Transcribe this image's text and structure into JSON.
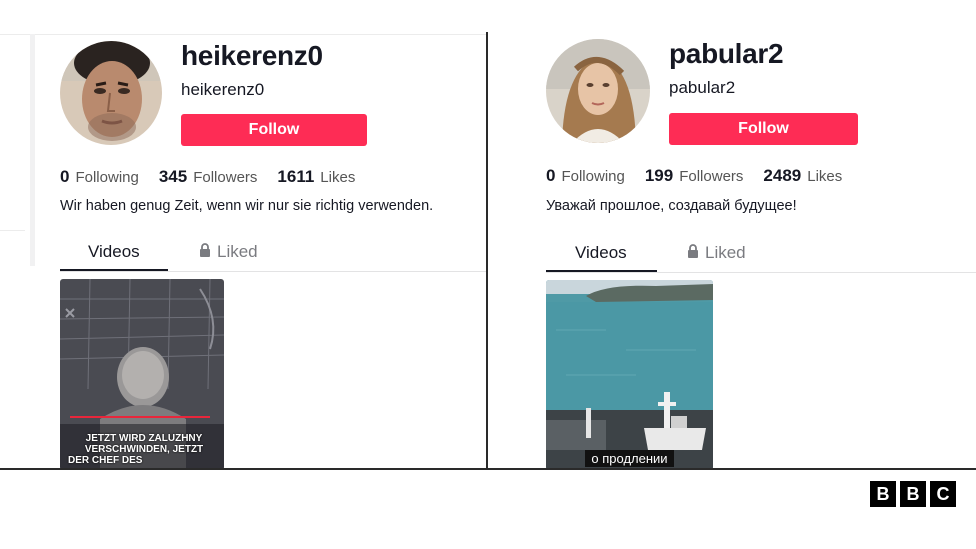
{
  "profiles": [
    {
      "username": "heikerenz0",
      "handle": "heikerenz0",
      "follow_label": "Follow",
      "following_count": "0",
      "following_label": "Following",
      "followers_count": "345",
      "followers_label": "Followers",
      "likes_count": "1611",
      "likes_label": "Likes",
      "bio": "Wir haben genug Zeit, wenn wir nur sie richtig verwenden.",
      "tabs": [
        {
          "label": "Videos"
        },
        {
          "label": "Liked"
        }
      ],
      "video": {
        "caption_lines": [
          "JETZT WIRD ZALUZHNY",
          "VERSCHWINDEN, JETZT",
          "DER CHEF DES"
        ]
      }
    },
    {
      "username": "pabular2",
      "handle": "pabular2",
      "follow_label": "Follow",
      "following_count": "0",
      "following_label": "Following",
      "followers_count": "199",
      "followers_label": "Followers",
      "likes_count": "2489",
      "likes_label": "Likes",
      "bio": "Уважай прошлое, создавай будущее!",
      "tabs": [
        {
          "label": "Videos"
        },
        {
          "label": "Liked"
        }
      ],
      "video": {
        "caption": "о продлении"
      }
    }
  ],
  "brand": {
    "letters": [
      "B",
      "B",
      "C"
    ]
  },
  "colors": {
    "follow": "#fe2c55",
    "text": "#161823",
    "muted": "#7a7b80"
  },
  "icons": {
    "liked_tab": "lock-icon"
  }
}
